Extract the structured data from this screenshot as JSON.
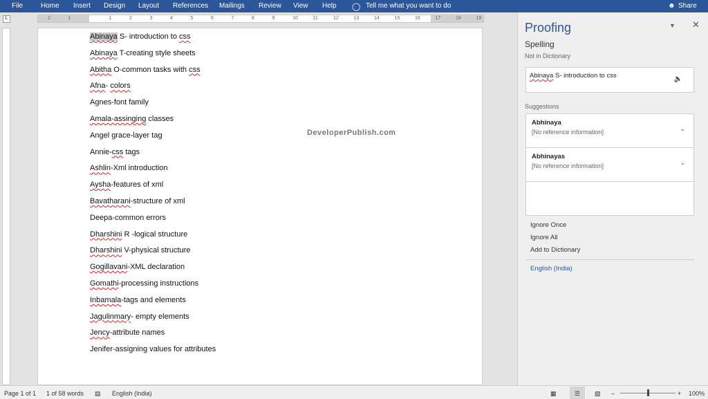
{
  "ribbon": {
    "tabs": [
      "File",
      "Home",
      "Insert",
      "Design",
      "Layout",
      "References",
      "Mailings",
      "Review",
      "View",
      "Help"
    ],
    "tell_me": "Tell me what you want to do",
    "share": "Share",
    "color": "#2b579a"
  },
  "ruler": {
    "ticks": [
      "2",
      "1",
      "",
      "1",
      "2",
      "3",
      "4",
      "5",
      "6",
      "7",
      "8",
      "9",
      "10",
      "11",
      "12",
      "13",
      "14",
      "15",
      "16",
      "17",
      "18",
      "19"
    ]
  },
  "document": {
    "lines": [
      [
        {
          "t": "Abinaya",
          "e": true,
          "s": true
        },
        {
          "t": " S- introduction to "
        },
        {
          "t": "css",
          "e": true
        }
      ],
      [
        {
          "t": "Abinaya",
          "e": true
        },
        {
          "t": " T-creating style sheets"
        }
      ],
      [
        {
          "t": "Abitha",
          "e": true
        },
        {
          "t": " O-common tasks with "
        },
        {
          "t": "css",
          "e": true
        }
      ],
      [
        {
          "t": "Afna",
          "e": true
        },
        {
          "t": "- "
        },
        {
          "t": "colors",
          "e": true
        }
      ],
      [
        {
          "t": "Agnes-font family"
        }
      ],
      [
        {
          "t": "Amala-assinging",
          "e": true
        },
        {
          "t": " classes"
        }
      ],
      [
        {
          "t": "Angel grace-layer tag"
        }
      ],
      [
        {
          "t": "Annie-"
        },
        {
          "t": "css",
          "e": true
        },
        {
          "t": " tags"
        }
      ],
      [
        {
          "t": "Ashlin",
          "e": true
        },
        {
          "t": "-Xml introduction"
        }
      ],
      [
        {
          "t": "Aysha",
          "e": true
        },
        {
          "t": "-features of xml"
        }
      ],
      [
        {
          "t": "Bavatharani",
          "e": true
        },
        {
          "t": "-structure of xml"
        }
      ],
      [
        {
          "t": "Deepa-common errors"
        }
      ],
      [
        {
          "t": "Dharshini",
          "e": true
        },
        {
          "t": " R -logical structure"
        }
      ],
      [
        {
          "t": "Dharshini",
          "e": true
        },
        {
          "t": " V-physical structure"
        }
      ],
      [
        {
          "t": "Gogillavani",
          "e": true
        },
        {
          "t": "-XML declaration"
        }
      ],
      [
        {
          "t": "Gomathi",
          "e": true
        },
        {
          "t": "-processing instructions"
        }
      ],
      [
        {
          "t": "Inbamala",
          "e": true
        },
        {
          "t": "-tags and elements"
        }
      ],
      [
        {
          "t": "Jagulinmary",
          "e": true
        },
        {
          "t": "- empty elements"
        }
      ],
      [
        {
          "t": "Jency",
          "e": true
        },
        {
          "t": "-attribute names"
        }
      ],
      [
        {
          "t": "Jenifer-assigning values for attributes"
        }
      ]
    ],
    "watermark": "DeveloperPublish.com"
  },
  "proofing": {
    "title": "Proofing",
    "subtitle": "Spelling",
    "not_in_dictionary": "Not in Dictionary",
    "context_word": "Abinaya",
    "context_rest": " S- introduction to css",
    "suggestions_label": "Suggestions",
    "suggestions": [
      {
        "word": "Abhinaya",
        "info": "[No reference information]"
      },
      {
        "word": "Abhinayas",
        "info": "[No reference information]"
      }
    ],
    "ignore_once": "Ignore Once",
    "ignore_all": "Ignore All",
    "add_to_dictionary": "Add to Dictionary",
    "language": "English (India)"
  },
  "status": {
    "page": "Page 1 of 1",
    "words": "1 of 58 words",
    "language": "English (India)",
    "zoom": "100%",
    "zoom_percent": 100
  }
}
